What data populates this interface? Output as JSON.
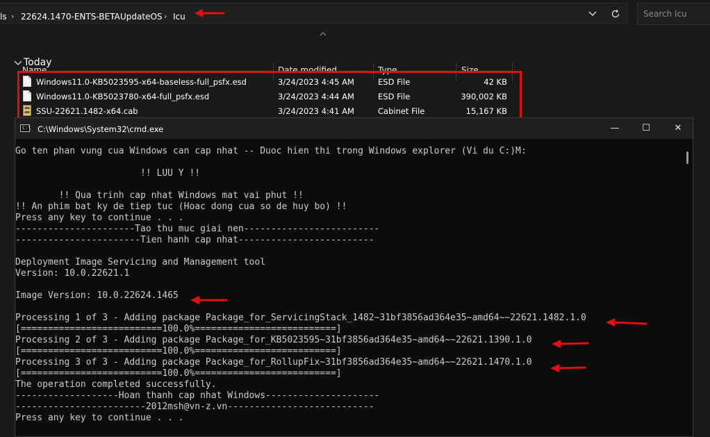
{
  "explorer": {
    "breadcrumb": [
      "ls",
      "22624.1470-ENTS-BETA",
      "UpdateOS",
      "Icu"
    ],
    "search_placeholder": "Search Icu",
    "columns": [
      "Name",
      "Date modified",
      "Type",
      "Size"
    ],
    "group_label": "Today",
    "files": [
      {
        "name": "Windows11.0-KB5023595-x64-baseless-full_psfx.esd",
        "date": "3/24/2023 4:45 AM",
        "type": "ESD File",
        "size": "42 KB",
        "icon": "file-icon"
      },
      {
        "name": "Windows11.0-KB5023780-x64-full_psfx.esd",
        "date": "3/24/2023 4:44 AM",
        "type": "ESD File",
        "size": "390,002 KB",
        "icon": "file-icon"
      },
      {
        "name": "SSU-22621.1482-x64.cab",
        "date": "3/24/2023 4:41 AM",
        "type": "Cabinet File",
        "size": "15,167 KB",
        "icon": "cabinet-icon"
      }
    ]
  },
  "cmd": {
    "title": "C:\\Windows\\System32\\cmd.exe",
    "minimize": "—",
    "maximize": "☐",
    "close": "✕",
    "lines": [
      "Go ten phan vung cua Windows can cap nhat -- Duoc hien thi trong Windows explorer (Vi du C:)M:",
      "",
      "                       !! LUU Y !!",
      "",
      "        !! Qua trinh cap nhat Windows mat vai phut !!",
      "!! An phim bat ky de tiep tuc (Hoac dong cua so de huy bo) !!",
      "Press any key to continue . . .",
      "----------------------Tao thu muc giai nen-------------------------",
      "-----------------------Tien hanh cap nhat-------------------------",
      "",
      "Deployment Image Servicing and Management tool",
      "Version: 10.0.22621.1",
      "",
      "Image Version: 10.0.22624.1465",
      "",
      "Processing 1 of 3 - Adding package Package_for_ServicingStack_1482~31bf3856ad364e35~amd64~~22621.1482.1.0",
      "[==========================100.0%==========================]",
      "Processing 2 of 3 - Adding package Package_for_KB5023595~31bf3856ad364e35~amd64~~22621.1390.1.0",
      "[==========================100.0%==========================]",
      "Processing 3 of 3 - Adding package Package_for_RollupFix~31bf3856ad364e35~amd64~~22621.1470.1.0",
      "[==========================100.0%==========================]",
      "The operation completed successfully.",
      "-------------------Hoan thanh cap nhat Windows---------------------",
      "------------------------2012msh@vn-z.vn---------------------------",
      "Press any key to continue . . ."
    ]
  },
  "colors": {
    "annotation_red": "#e01010",
    "cmd_background": "#0c0c0c",
    "explorer_background": "#191919"
  }
}
